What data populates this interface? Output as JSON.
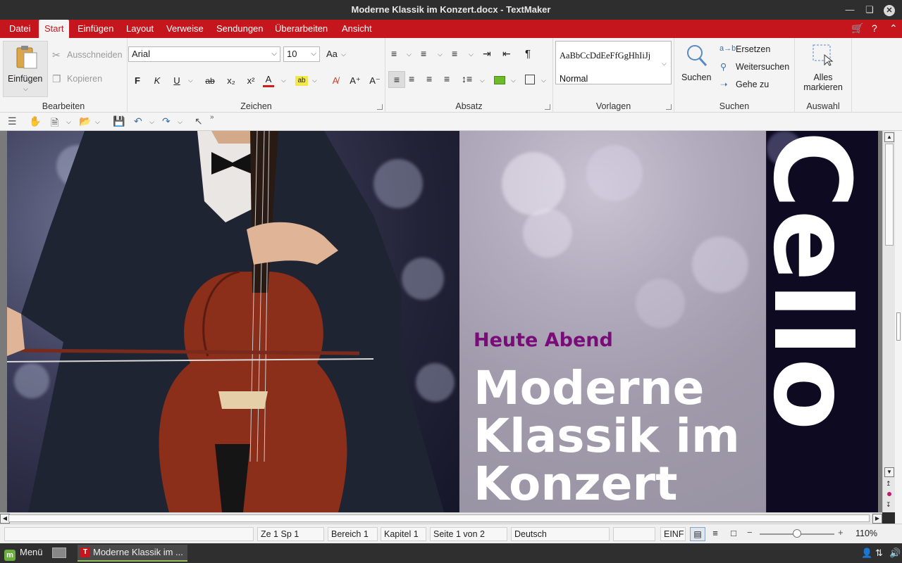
{
  "window": {
    "title": "Moderne Klassik im Konzert.docx - TextMaker"
  },
  "menubar": {
    "items": [
      "Datei",
      "Start",
      "Einfügen",
      "Layout",
      "Verweise",
      "Sendungen",
      "Überarbeiten",
      "Ansicht"
    ],
    "active": "Start"
  },
  "ribbon": {
    "bearbeiten": {
      "label": "Bearbeiten",
      "paste": "Einfügen",
      "cut": "Ausschneiden",
      "copy": "Kopieren"
    },
    "zeichen": {
      "label": "Zeichen",
      "font": "Arial",
      "size": "10",
      "bold": "F",
      "italic": "K",
      "underline": "U",
      "strike": "ab",
      "sub": "x₂",
      "sup": "x²",
      "fontcolor": "A"
    },
    "absatz": {
      "label": "Absatz"
    },
    "vorlagen": {
      "label": "Vorlagen",
      "sample": "AaBbCcDdEeFfGgHhIiJj",
      "current": "Normal"
    },
    "suchen": {
      "label": "Suchen",
      "search": "Suchen",
      "replace": "Ersetzen",
      "findnext": "Weitersuchen",
      "goto": "Gehe zu"
    },
    "auswahl": {
      "label": "Auswahl",
      "selectall_line1": "Alles",
      "selectall_line2": "markieren"
    }
  },
  "document": {
    "tonight": "Heute Abend",
    "headline_line1": "Moderne",
    "headline_line2": "Klassik im",
    "headline_line3": "Konzert",
    "strip_word": "Cello"
  },
  "statusbar": {
    "position": "Ze 1 Sp 1",
    "section": "Bereich 1",
    "chapter": "Kapitel 1",
    "page": "Seite 1 von 2",
    "language": "Deutsch",
    "mode": "EINF",
    "zoom": "110%"
  },
  "taskbar": {
    "menu": "Menü",
    "task": "Moderne Klassik im ..."
  },
  "colors": {
    "accent": "#c4161c",
    "tonight": "#7a0c7a"
  }
}
